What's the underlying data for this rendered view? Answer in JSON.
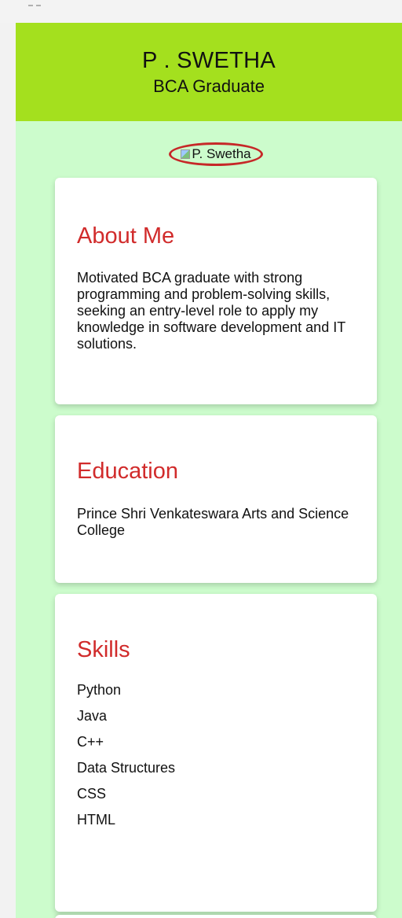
{
  "header": {
    "name": "P . SWETHA",
    "role": "BCA Graduate"
  },
  "profile": {
    "image_alt": "P. Swetha"
  },
  "about": {
    "title": "About Me",
    "text": "Motivated BCA graduate with strong programming and problem-solving skills, seeking an entry-level role to apply my knowledge in software development and IT solutions."
  },
  "education": {
    "title": "Education",
    "text": "Prince Shri Venkateswara Arts and Science College"
  },
  "skills": {
    "title": "Skills",
    "items": [
      "Python",
      "Java",
      "C++",
      "Data Structures",
      "CSS",
      "HTML"
    ]
  },
  "colors": {
    "header_bg": "#a4e01e",
    "page_bg": "#ccfccc",
    "heading": "#d12b2b",
    "image_border": "#c62828"
  }
}
